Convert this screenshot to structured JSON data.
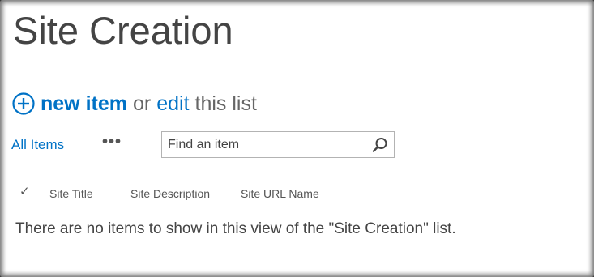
{
  "page": {
    "title": "Site Creation"
  },
  "commands": {
    "new_item_label": "new item",
    "or_text": "or",
    "edit_label": "edit",
    "this_list_text": "this list"
  },
  "views": {
    "current_view": "All Items",
    "more_options": "•••"
  },
  "search": {
    "placeholder": "Find an item"
  },
  "list": {
    "select_all_glyph": "✓",
    "columns": [
      "Site Title",
      "Site Description",
      "Site URL Name"
    ],
    "empty_message": "There are no items to show in this view of the \"Site Creation\" list."
  },
  "icons": {
    "add": "add-circle-icon",
    "search": "search-icon",
    "check": "checkmark-icon"
  },
  "colors": {
    "accent": "#0072c6",
    "text": "#444444",
    "muted": "#666666"
  }
}
